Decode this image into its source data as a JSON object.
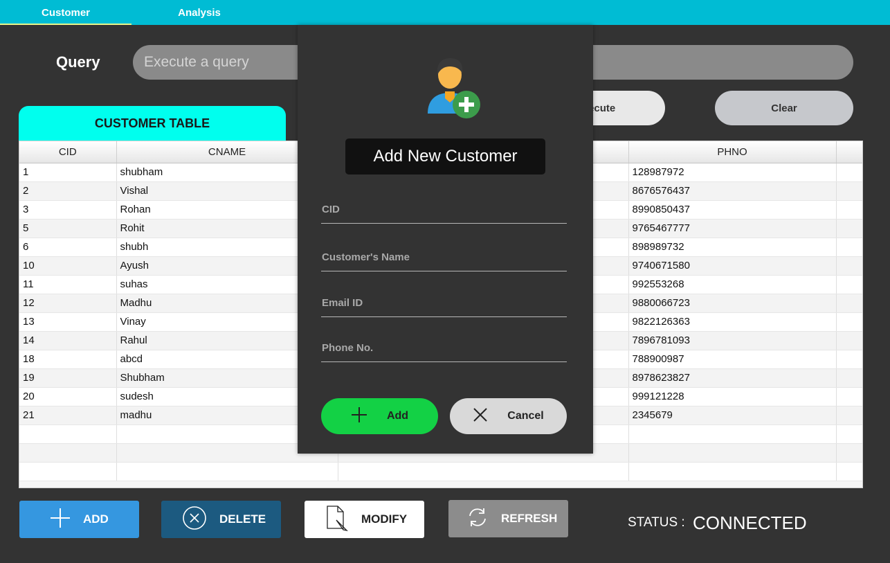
{
  "tabs": [
    {
      "label": "Customer",
      "active": true
    },
    {
      "label": "Analysis",
      "active": false
    }
  ],
  "query": {
    "label": "Query",
    "placeholder": "Execute a query",
    "execute_label": "Execute",
    "clear_label": "Clear"
  },
  "table": {
    "title": "CUSTOMER TABLE",
    "columns": [
      "CID",
      "CNAME",
      "",
      "PHNO",
      ""
    ],
    "rows": [
      [
        "1",
        "shubham",
        "",
        "128987972"
      ],
      [
        "2",
        "Vishal",
        "",
        "8676576437"
      ],
      [
        "3",
        "Rohan",
        "",
        "8990850437"
      ],
      [
        "5",
        "Rohit",
        "",
        "9765467777"
      ],
      [
        "6",
        "shubh",
        "",
        "898989732"
      ],
      [
        "10",
        "Ayush",
        "",
        "9740671580"
      ],
      [
        "11",
        "suhas",
        "",
        "992553268"
      ],
      [
        "12",
        "Madhu",
        "",
        "9880066723"
      ],
      [
        "13",
        "Vinay",
        "",
        "9822126363"
      ],
      [
        "14",
        "Rahul",
        "",
        "7896781093"
      ],
      [
        "18",
        "abcd",
        "",
        "788900987"
      ],
      [
        "19",
        "Shubham",
        "",
        "8978623827"
      ],
      [
        "20",
        "sudesh",
        "",
        "999121228"
      ],
      [
        "21",
        "madhu",
        "",
        "2345679"
      ]
    ]
  },
  "actions": {
    "add": "ADD",
    "delete": "DELETE",
    "modify": "MODIFY",
    "refresh": "REFRESH"
  },
  "status": {
    "label": "STATUS :",
    "value": "CONNECTED"
  },
  "modal": {
    "title": "Add New Customer",
    "fields": {
      "cid": "CID",
      "name": "Customer's Name",
      "email": "Email ID",
      "phone": "Phone No."
    },
    "add_label": "Add",
    "cancel_label": "Cancel"
  },
  "colors": {
    "tabbar": "#00bcd4",
    "table_title": "#00ffee",
    "add_button": "#3597e0",
    "delete_button": "#1c5a80",
    "modal_add": "#13d145"
  }
}
